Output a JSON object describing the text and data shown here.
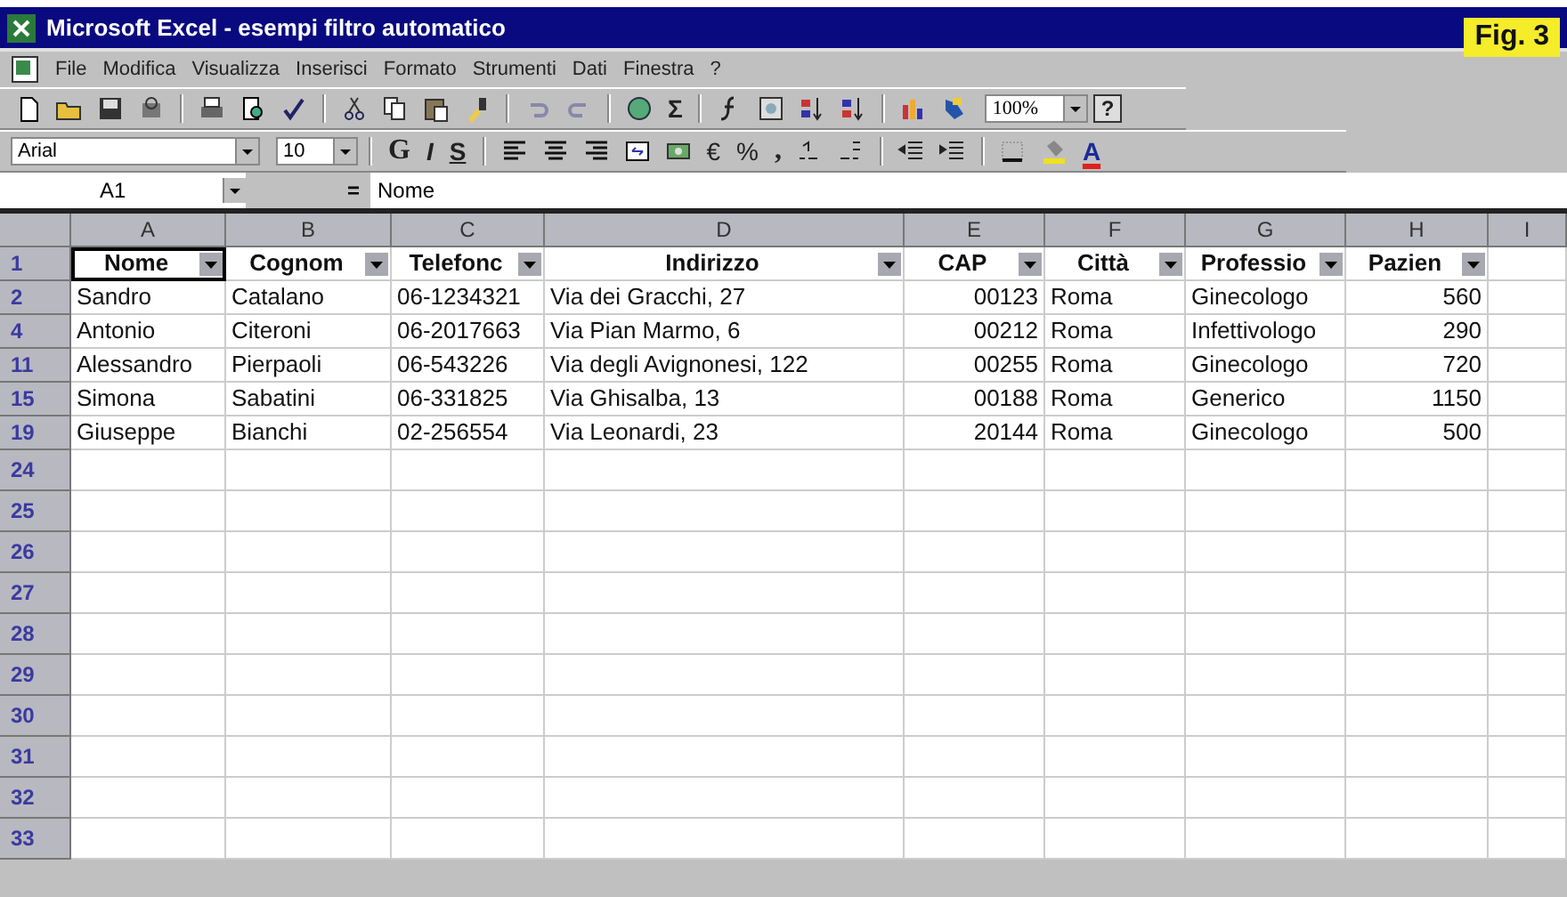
{
  "window": {
    "title": "Microsoft Excel - esempi filtro automatico"
  },
  "figure_label": "Fig. 3",
  "menu": [
    "File",
    "Modifica",
    "Visualizza",
    "Inserisci",
    "Formato",
    "Strumenti",
    "Dati",
    "Finestra",
    "?"
  ],
  "standard_toolbar": {
    "sum": "Σ",
    "zoom": "100%",
    "help": "?"
  },
  "format_toolbar": {
    "font": "Arial",
    "size": "10",
    "bold": "G",
    "italic": "I",
    "underline": "S",
    "euro": "€",
    "percent": "%",
    "comma": ",",
    "font_color": "A"
  },
  "formula_bar": {
    "name_box": "A1",
    "equals": "=",
    "content": "Nome"
  },
  "columns": [
    "A",
    "B",
    "C",
    "D",
    "E",
    "F",
    "G",
    "H",
    "I"
  ],
  "rows": [
    {
      "number": "1",
      "cells": [
        {
          "text": "Nome",
          "selected": true
        },
        {
          "text": "Cognom",
          "selected": false
        },
        {
          "text": "Telefonc",
          "selected": false
        },
        {
          "text": "Indirizzo",
          "selected": false
        },
        {
          "text": "CAP",
          "selected": false
        },
        {
          "text": "Città",
          "selected": false
        },
        {
          "text": "Professio",
          "selected": false
        },
        {
          "text": "Pazien",
          "selected": false
        }
      ],
      "kind": "header"
    },
    {
      "number": "2",
      "cells": [
        {
          "text": "Sandro"
        },
        {
          "text": "Catalano"
        },
        {
          "text": "06-1234321"
        },
        {
          "text": "Via dei Gracchi, 27"
        },
        {
          "text": "00123"
        },
        {
          "text": "Roma"
        },
        {
          "text": "Ginecologo"
        },
        {
          "text": "560"
        }
      ],
      "kind": "data"
    },
    {
      "number": "4",
      "cells": [
        {
          "text": "Antonio"
        },
        {
          "text": "Citeroni"
        },
        {
          "text": "06-2017663"
        },
        {
          "text": "Via Pian Marmo, 6"
        },
        {
          "text": "00212"
        },
        {
          "text": "Roma"
        },
        {
          "text": "Infettivologo"
        },
        {
          "text": "290"
        }
      ],
      "kind": "data"
    },
    {
      "number": "11",
      "cells": [
        {
          "text": "Alessandro"
        },
        {
          "text": "Pierpaoli"
        },
        {
          "text": "06-543226"
        },
        {
          "text": "Via degli Avignonesi, 122"
        },
        {
          "text": "00255"
        },
        {
          "text": "Roma"
        },
        {
          "text": "Ginecologo"
        },
        {
          "text": "720"
        }
      ],
      "kind": "data"
    },
    {
      "number": "15",
      "cells": [
        {
          "text": "Simona"
        },
        {
          "text": "Sabatini"
        },
        {
          "text": "06-331825"
        },
        {
          "text": "Via Ghisalba, 13"
        },
        {
          "text": "00188"
        },
        {
          "text": "Roma"
        },
        {
          "text": "Generico"
        },
        {
          "text": "1150"
        }
      ],
      "kind": "data"
    },
    {
      "number": "19",
      "cells": [
        {
          "text": "Giuseppe"
        },
        {
          "text": "Bianchi"
        },
        {
          "text": "02-256554"
        },
        {
          "text": "Via Leonardi, 23"
        },
        {
          "text": "20144"
        },
        {
          "text": "Roma"
        },
        {
          "text": "Ginecologo"
        },
        {
          "text": "500"
        }
      ],
      "kind": "data"
    },
    {
      "number": "24",
      "kind": "empty"
    },
    {
      "number": "25",
      "kind": "empty"
    },
    {
      "number": "26",
      "kind": "empty"
    },
    {
      "number": "27",
      "kind": "empty"
    },
    {
      "number": "28",
      "kind": "empty"
    },
    {
      "number": "29",
      "kind": "empty"
    },
    {
      "number": "30",
      "kind": "empty"
    },
    {
      "number": "31",
      "kind": "empty"
    },
    {
      "number": "32",
      "kind": "empty"
    },
    {
      "number": "33",
      "kind": "empty"
    }
  ]
}
